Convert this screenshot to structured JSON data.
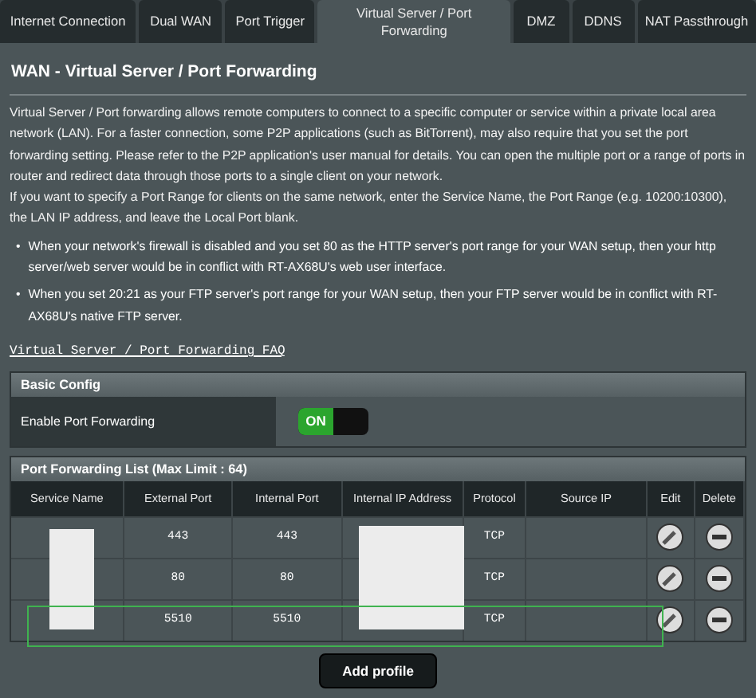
{
  "tabs": [
    {
      "label": "Internet Connection",
      "selected": false
    },
    {
      "label": "Dual WAN",
      "selected": false
    },
    {
      "label": "Port Trigger",
      "selected": false
    },
    {
      "label": "Virtual Server / Port Forwarding",
      "selected": true
    },
    {
      "label": "DMZ",
      "selected": false
    },
    {
      "label": "DDNS",
      "selected": false
    },
    {
      "label": "NAT Passthrough",
      "selected": false
    }
  ],
  "title": "WAN - Virtual Server / Port Forwarding",
  "intro": [
    "Virtual Server / Port forwarding allows remote computers to connect to a specific computer or service within a private local area network (LAN). For a faster connection, some P2P applications (such as BitTorrent), may also require that you set the port forwarding setting. Please refer to the P2P application's user manual for details. You can open the multiple port or a range of ports in router and redirect data through those ports to a single client on your network.",
    "If you want to specify a Port Range for clients on the same network, enter the Service Name, the Port Range (e.g. 10200:10300), the LAN IP address, and leave the Local Port blank."
  ],
  "notes": [
    {
      "bullet": "•",
      "text": "When your network's firewall is disabled and you set 80 as the HTTP server's port range for your WAN setup, then your http server/web server would be in conflict with RT-AX68U's web user interface."
    },
    {
      "bullet": "•",
      "text": "When you set 20:21 as your FTP server's port range for your WAN setup, then your FTP server would be in conflict with RT-AX68U's native FTP server."
    }
  ],
  "faq_link": "Virtual Server / Port Forwarding FAQ",
  "basic_config": {
    "title": "Basic Config",
    "label": "Enable Port Forwarding",
    "toggle": {
      "on": true,
      "label": "ON"
    }
  },
  "list": {
    "title": "Port Forwarding List (Max Limit : 64)",
    "columns": [
      "Service Name",
      "External Port",
      "Internal Port",
      "Internal IP Address",
      "Protocol",
      "Source IP",
      "Edit",
      "Delete"
    ],
    "rows": [
      {
        "external_port": "443",
        "internal_port": "443",
        "protocol": "TCP",
        "highlighted": false
      },
      {
        "external_port": "80",
        "internal_port": "80",
        "protocol": "TCP",
        "highlighted": false
      },
      {
        "external_port": "5510",
        "internal_port": "5510",
        "protocol": "TCP",
        "highlighted": true
      }
    ]
  },
  "add_button": "Add profile"
}
